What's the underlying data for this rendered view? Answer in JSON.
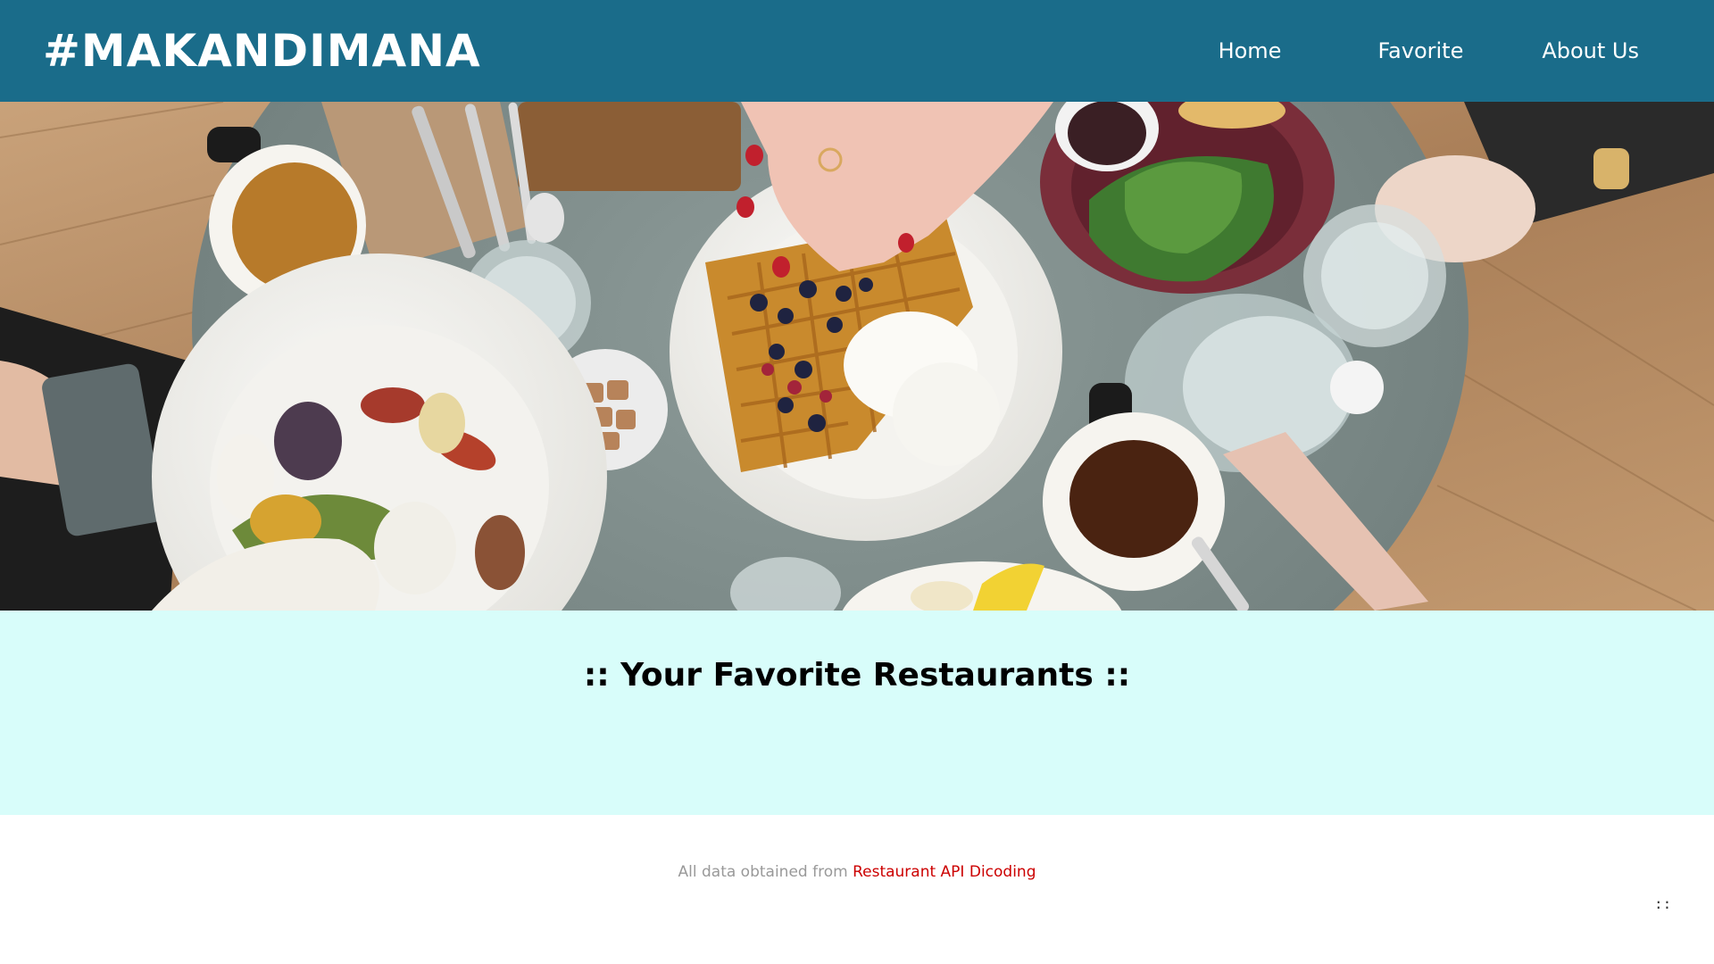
{
  "header": {
    "brand": "#MAKANDIMANA",
    "nav": [
      {
        "label": "Home"
      },
      {
        "label": "Favorite"
      },
      {
        "label": "About Us"
      }
    ]
  },
  "hero": {
    "icon": "restaurant-table-photo"
  },
  "favorites": {
    "title": ":: Your Favorite Restaurants ::"
  },
  "footer": {
    "prefix": "All data obtained from",
    "link_text": "Restaurant API Dicoding",
    "corner_mark": "::"
  },
  "colors": {
    "header_bg": "#1a6c8a",
    "section_bg": "#d8fdfa",
    "link_color": "#cc0000"
  }
}
